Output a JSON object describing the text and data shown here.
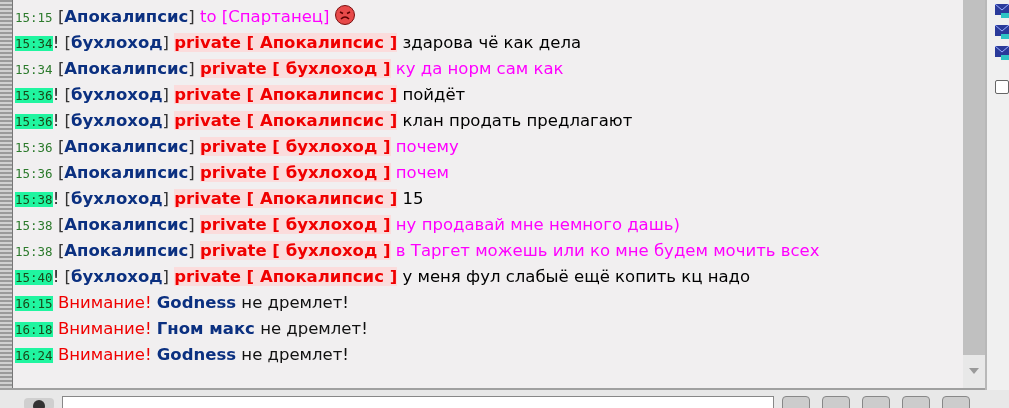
{
  "messages": [
    {
      "kind": "to",
      "time": "15:15",
      "time_highlight": false,
      "sender": "[**Апокалипсис**]",
      "target": "to [Спартанец]",
      "smiley": true
    },
    {
      "kind": "private",
      "time": "15:34",
      "time_highlight": true,
      "mark": "!",
      "sender": "[**бухлоход**]",
      "target": "private [ Апокалипсис ]",
      "text": "здарова чё как дела",
      "color": "#000000"
    },
    {
      "kind": "private",
      "time": "15:34",
      "time_highlight": false,
      "sender": "[**Апокалипсис**]",
      "target": "private [ бухлоход ]",
      "text": "ку да норм сам как",
      "color": "#ff00ff"
    },
    {
      "kind": "private",
      "time": "15:36",
      "time_highlight": true,
      "mark": "!",
      "sender": "[**бухлоход**]",
      "target": "private [ Апокалипсис ]",
      "text": "пойдёт",
      "color": "#000000"
    },
    {
      "kind": "private",
      "time": "15:36",
      "time_highlight": true,
      "mark": "!",
      "sender": "[**бухлоход**]",
      "target": "private [ Апокалипсис ]",
      "text": "клан продать предлагают",
      "color": "#000000"
    },
    {
      "kind": "private",
      "time": "15:36",
      "time_highlight": false,
      "sender": "[**Апокалипсис**]",
      "target": "private [ бухлоход ]",
      "text": "почему",
      "color": "#ff00ff"
    },
    {
      "kind": "private",
      "time": "15:36",
      "time_highlight": false,
      "sender": "[**Апокалипсис**]",
      "target": "private [ бухлоход ]",
      "text": "почем",
      "color": "#ff00ff"
    },
    {
      "kind": "private",
      "time": "15:38",
      "time_highlight": true,
      "mark": "!",
      "sender": "[**бухлоход**]",
      "target": "private [ Апокалипсис ]",
      "text": "15",
      "color": "#000000"
    },
    {
      "kind": "private",
      "time": "15:38",
      "time_highlight": false,
      "sender": "[**Апокалипсис**]",
      "target": "private [ бухлоход ]",
      "text": "ну продавай мне немного дашь)",
      "color": "#ff00ff"
    },
    {
      "kind": "private",
      "time": "15:38",
      "time_highlight": false,
      "sender": "[**Апокалипсис**]",
      "target": "private [ бухлоход ]",
      "text": "в Таргет можешь или ко мне будем мочить всех",
      "color": "#ff00ff"
    },
    {
      "kind": "private",
      "time": "15:40",
      "time_highlight": true,
      "mark": "!",
      "sender": "[**бухлоход**]",
      "target": "private [ Апокалипсис ]",
      "text": "у меня фул слабыё ещё копить кц надо",
      "color": "#000000"
    },
    {
      "kind": "alert",
      "time": "16:15",
      "time_highlight": true,
      "label": "Внимание!",
      "name": "Godness",
      "text": "не дремлет!"
    },
    {
      "kind": "alert",
      "time": "16:18",
      "time_highlight": true,
      "label": "Внимание!",
      "name": "Гном макс",
      "text": "не дремлет!"
    },
    {
      "kind": "alert",
      "time": "16:24",
      "time_highlight": true,
      "label": "Внимание!",
      "name": "Godness",
      "text": "не дремлет!"
    }
  ],
  "side_checkbox": {
    "checked": false
  }
}
